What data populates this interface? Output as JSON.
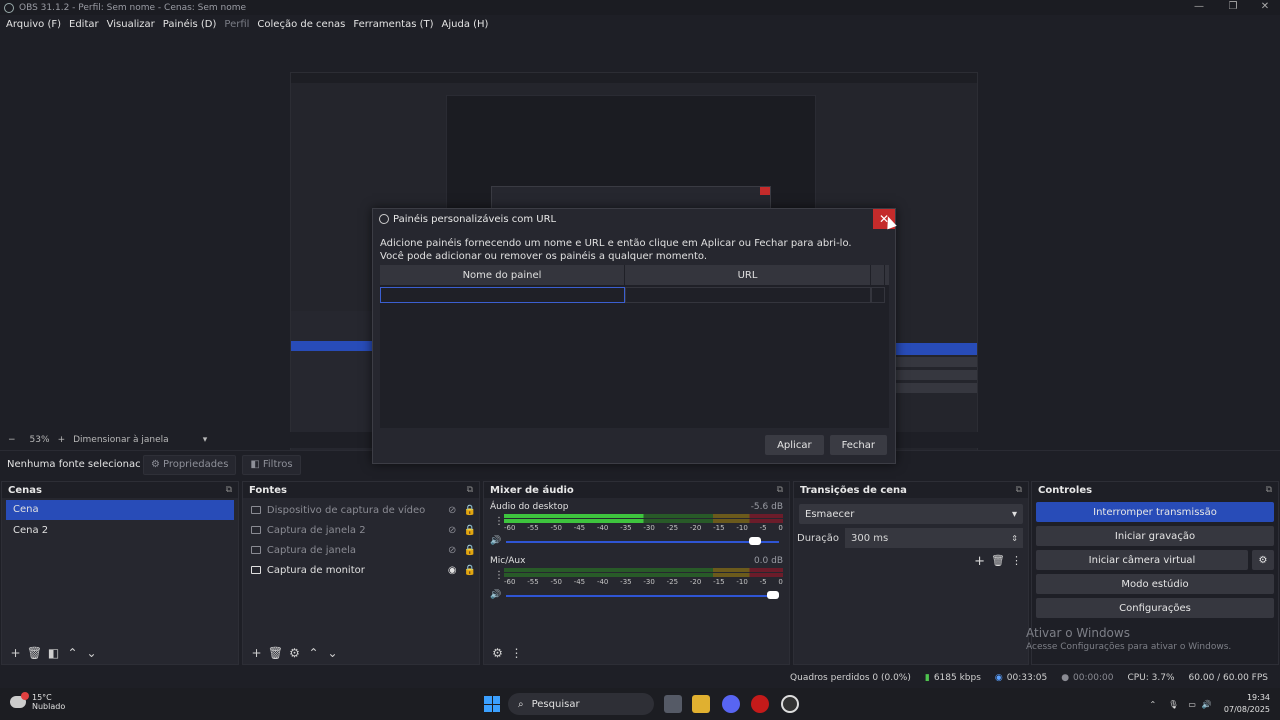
{
  "window": {
    "title": "OBS 31.1.2 - Perfil: Sem nome - Cenas: Sem nome"
  },
  "menu": [
    {
      "label": "Arquivo (F)",
      "enabled": true
    },
    {
      "label": "Editar",
      "enabled": true
    },
    {
      "label": "Visualizar",
      "enabled": true
    },
    {
      "label": "Painéis (D)",
      "enabled": true
    },
    {
      "label": "Perfil",
      "enabled": false
    },
    {
      "label": "Coleção de cenas",
      "enabled": true
    },
    {
      "label": "Ferramentas (T)",
      "enabled": true
    },
    {
      "label": "Ajuda (H)",
      "enabled": true
    }
  ],
  "zoombar": {
    "minus": "−",
    "zoom": "53%",
    "plus": "+",
    "mode": "Dimensionar à janela"
  },
  "source_toolbar": {
    "selected": "Nenhuma fonte selecionac",
    "properties": "Propriedades",
    "filters": "Filtros"
  },
  "scenes": {
    "title": "Cenas",
    "items": [
      "Cena",
      "Cena 2"
    ],
    "selected": 0
  },
  "sources": {
    "title": "Fontes",
    "items": [
      {
        "name": "Dispositivo de captura de vídeo",
        "visible": false
      },
      {
        "name": "Captura de janela 2",
        "visible": false
      },
      {
        "name": "Captura de janela",
        "visible": false
      },
      {
        "name": "Captura de monitor",
        "visible": true
      }
    ]
  },
  "mixer": {
    "title": "Mixer de áudio",
    "scale": [
      "-60",
      "-55",
      "-50",
      "-45",
      "-40",
      "-35",
      "-30",
      "-25",
      "-20",
      "-15",
      "-10",
      "-5",
      "0"
    ],
    "channels": [
      {
        "name": "Áudio do desktop",
        "db": "-5.6 dB",
        "volume": 0.93,
        "level": 0.5
      },
      {
        "name": "Mic/Aux",
        "db": "0.0 dB",
        "volume": 1.0,
        "level": 0.0
      }
    ]
  },
  "transitions": {
    "title": "Transições de cena",
    "selected": "Esmaecer",
    "duration_label": "Duração",
    "duration_value": "300 ms"
  },
  "controls": {
    "title": "Controles",
    "buttons": [
      "Interromper transmissão",
      "Iniciar gravação",
      "Iniciar câmera virtual",
      "Modo estúdio",
      "Configurações"
    ]
  },
  "watermark": {
    "line1": "Ativar o Windows",
    "line2": "Acesse Configurações para ativar o Windows."
  },
  "status": {
    "dropped": "Quadros perdidos 0 (0.0%)",
    "bitrate": "6185 kbps",
    "stream_time": "00:33:05",
    "rec_time": "00:00:00",
    "cpu": "CPU: 3.7%",
    "fps": "60.00 / 60.00 FPS"
  },
  "taskbar": {
    "temp": "15°C",
    "condition": "Nublado",
    "search": "Pesquisar",
    "time": "19:34",
    "date": "07/08/2025"
  },
  "dialog": {
    "title": "Painéis personalizáveis com URL",
    "description": "Adicione painéis fornecendo um nome e URL e então clique em Aplicar ou Fechar para abri-lo. Você pode adicionar ou remover os painéis a qualquer momento.",
    "col_name": "Nome do painel",
    "col_url": "URL",
    "apply": "Aplicar",
    "close": "Fechar",
    "close_glyph": "✕"
  },
  "colors": {
    "accent": "#284cb8",
    "close_red": "#c42b2b"
  }
}
